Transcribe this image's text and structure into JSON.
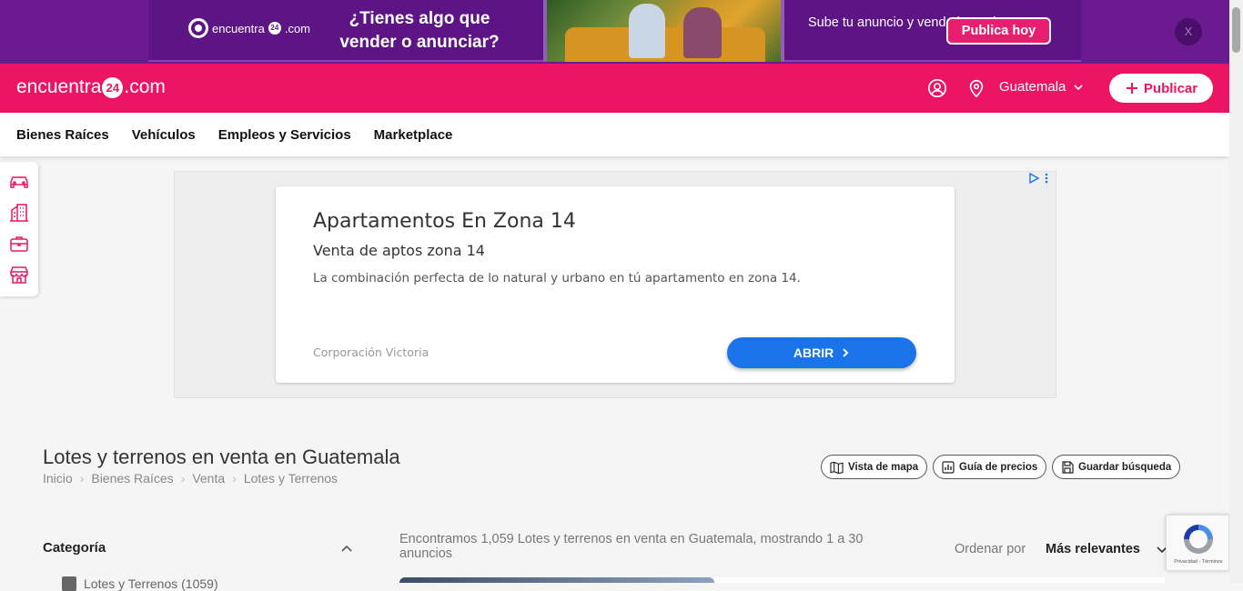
{
  "promo": {
    "logo_text": "encuentra",
    "logo_num": "24",
    "logo_suffix": ".com",
    "headline": "¿Tienes algo que vender o anunciar?",
    "subtext": "Sube tu anuncio y vende hoy mismo.",
    "cta": "Publica hoy",
    "close": "X"
  },
  "header": {
    "logo_text": "encuentra",
    "logo_num": "24",
    "logo_suffix": ".com",
    "country": "Guatemala",
    "publish": "Publicar"
  },
  "nav": {
    "items": [
      "Bienes Raíces",
      "Vehículos",
      "Empleos y Servicios",
      "Marketplace"
    ]
  },
  "side_rail": {
    "icons": [
      "car-icon",
      "building-icon",
      "briefcase-icon",
      "store-icon"
    ]
  },
  "ad": {
    "title": "Apartamentos En Zona 14",
    "subtitle": "Venta de aptos zona 14",
    "description": "La combinación perfecta de lo natural y urbano en tú apartamento en zona 14.",
    "advertiser": "Corporación Victoria",
    "cta": "ABRIR"
  },
  "page": {
    "title": "Lotes y terrenos en venta en Guatemala",
    "breadcrumbs": [
      "Inicio",
      "Bienes Raíces",
      "Venta",
      "Lotes y Terrenos"
    ],
    "tools": {
      "map": "Vista de mapa",
      "prices": "Guía de precios",
      "save": "Guardar búsqueda"
    }
  },
  "filters": {
    "heading": "Categoría",
    "first_item": "Lotes y Terrenos (1059)"
  },
  "results": {
    "summary": "Encontramos 1,059 Lotes y terrenos en venta en Guatemala, mostrando 1 a 30 anuncios",
    "sort_label": "Ordenar por",
    "sort_value": "Más relevantes"
  },
  "recaptcha": {
    "text": "Privacidad - Términos"
  },
  "colors": {
    "brand_pink": "#ec1563",
    "promo_purple": "#6b1a8f",
    "ad_blue": "#1a73e8"
  }
}
